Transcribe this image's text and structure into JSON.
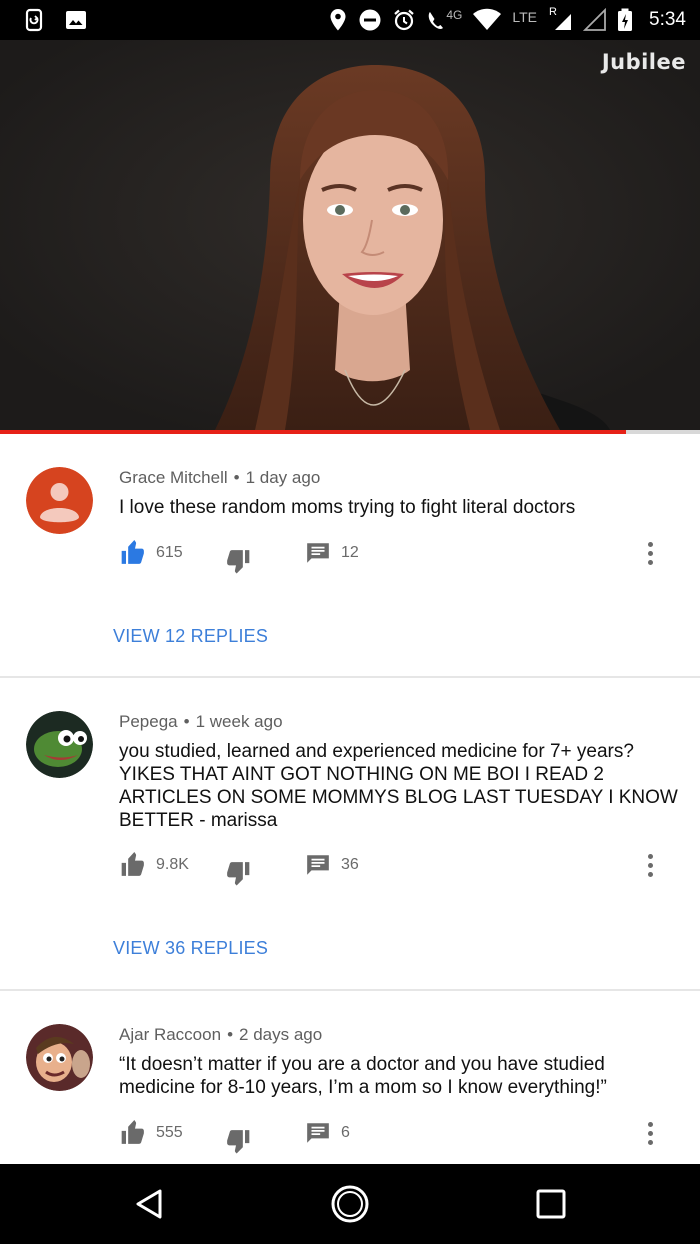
{
  "status_bar": {
    "time": "5:34",
    "network": "4G",
    "lte": "LTE",
    "roaming": "R"
  },
  "video": {
    "channel_logo": "Jubilee",
    "progress": 0.894
  },
  "comments": [
    {
      "author": "Grace Mitchell",
      "age": "1 day ago",
      "text": "I love these random moms trying to fight literal doctors",
      "likes": "615",
      "replies_count": "12",
      "liked": true,
      "view_replies": "VIEW 12 REPLIES"
    },
    {
      "author": "Pepega",
      "age": "1 week ago",
      "text": "you studied, learned and experienced medicine for 7+ years? YIKES THAT AINT GOT NOTHING ON ME BOI I READ 2 ARTICLES ON SOME MOMMYS BLOG LAST TUESDAY I KNOW BETTER - marissa",
      "likes": "9.8K",
      "replies_count": "36",
      "liked": false,
      "view_replies": "VIEW 36 REPLIES"
    },
    {
      "author": "Ajar Raccoon",
      "age": "2 days ago",
      "text": "“It doesn’t matter if you are a doctor and you have studied medicine for 8-10 years, I’m a mom so I know everything!”",
      "likes": "555",
      "replies_count": "6",
      "liked": false
    }
  ],
  "colors": {
    "accent_blue": "#3d7fd9",
    "progress_red": "#e62117",
    "avatar_default": "#d6441f"
  },
  "icons": {
    "like": "thumbs-up-icon",
    "dislike": "thumbs-down-icon",
    "reply": "comment-icon",
    "more": "more-vert-icon",
    "back": "back-triangle-icon",
    "home": "home-circle-icon",
    "recents": "recents-square-icon"
  }
}
